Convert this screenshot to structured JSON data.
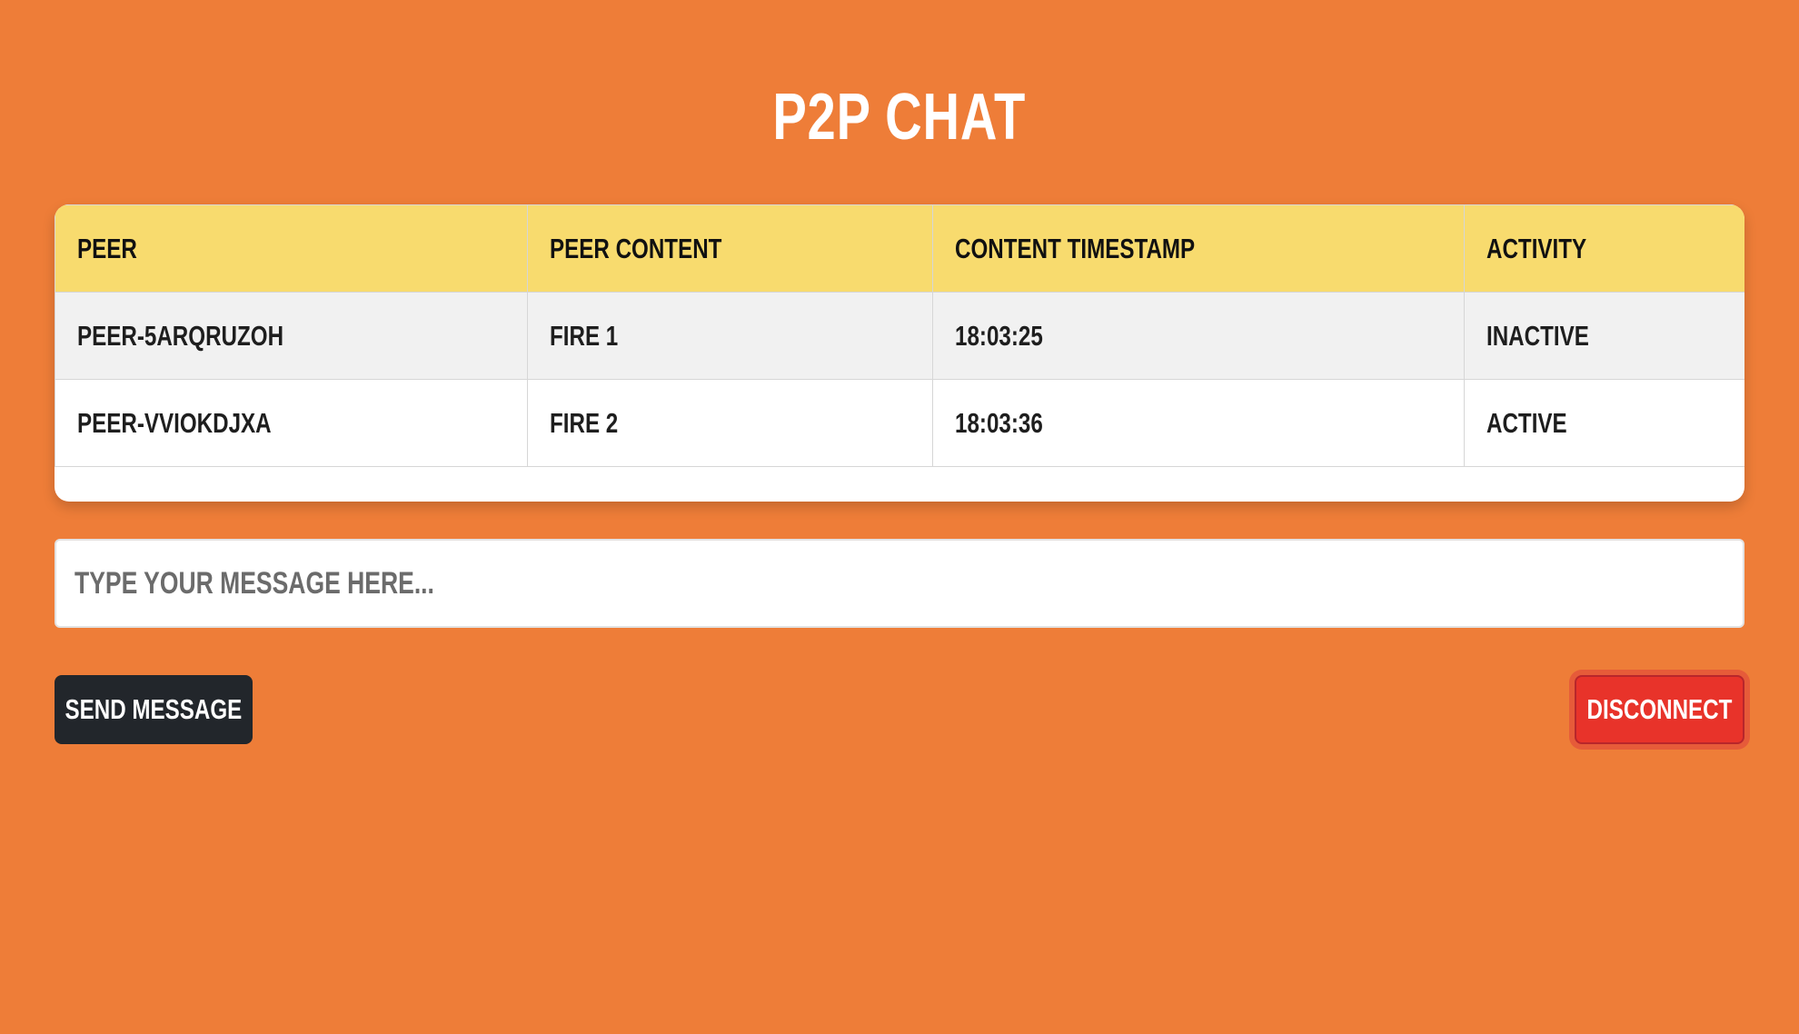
{
  "title": "P2P CHAT",
  "table": {
    "headers": [
      "PEER",
      "PEER CONTENT",
      "CONTENT TIMESTAMP",
      "ACTIVITY"
    ],
    "rows": [
      [
        "PEER-5ARQRUZOH",
        "FIRE 1",
        "18:03:25",
        "INACTIVE"
      ],
      [
        "PEER-VVIOKDJXA",
        "FIRE 2",
        "18:03:36",
        "ACTIVE"
      ]
    ]
  },
  "input": {
    "placeholder": "TYPE YOUR MESSAGE HERE..."
  },
  "buttons": {
    "send_label": "SEND MESSAGE",
    "disconnect_label": "DISCONNECT"
  },
  "colors": {
    "background": "#EE7D38",
    "header": "#F8DB6E",
    "send_button": "#22262B",
    "disconnect_button": "#E8332A"
  }
}
